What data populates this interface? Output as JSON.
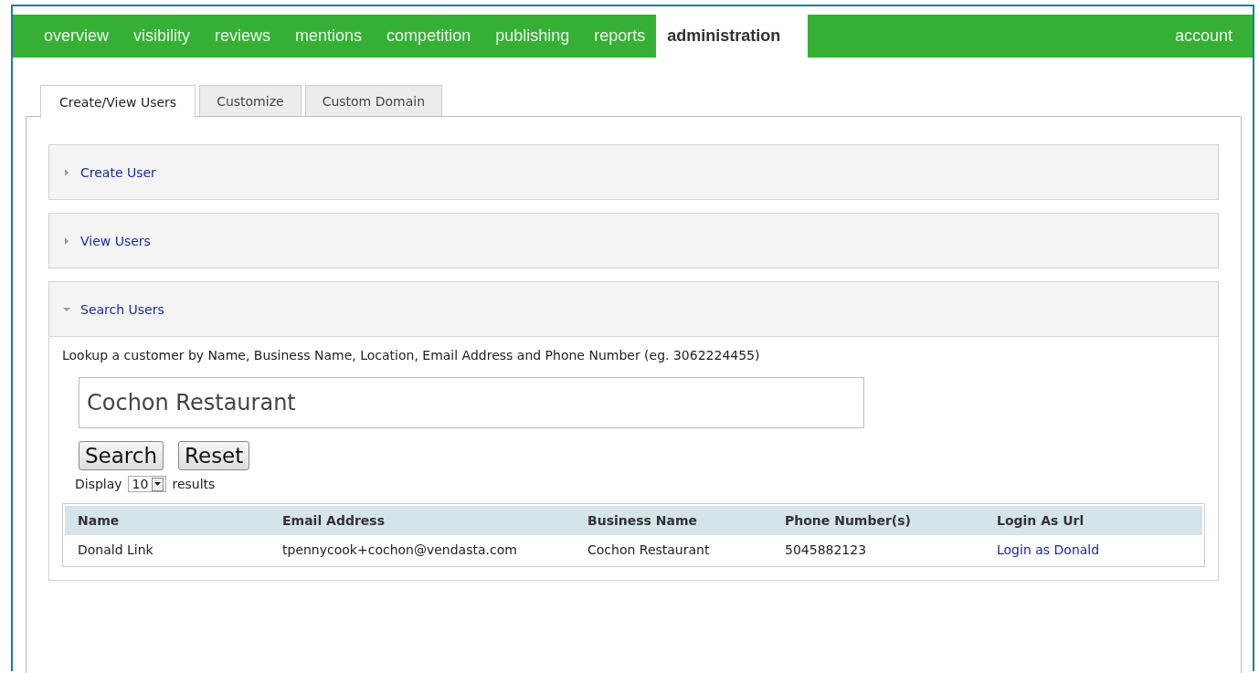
{
  "nav": {
    "items": [
      {
        "label": "overview",
        "selected": false
      },
      {
        "label": "visibility",
        "selected": false
      },
      {
        "label": "reviews",
        "selected": false
      },
      {
        "label": "mentions",
        "selected": false
      },
      {
        "label": "competition",
        "selected": false
      },
      {
        "label": "publishing",
        "selected": false
      },
      {
        "label": "reports",
        "selected": false
      },
      {
        "label": "administration",
        "selected": true
      }
    ],
    "account": "account"
  },
  "tabs": [
    {
      "label": "Create/View Users",
      "selected": true
    },
    {
      "label": "Customize",
      "selected": false
    },
    {
      "label": "Custom Domain",
      "selected": false
    }
  ],
  "sections": [
    {
      "title": "Create User",
      "expanded": false
    },
    {
      "title": "View Users",
      "expanded": false
    },
    {
      "title": "Search Users",
      "expanded": true
    }
  ],
  "search": {
    "hint": "Lookup a customer by Name, Business Name, Location, Email Address and Phone Number (eg. 3062224455)",
    "value": "Cochon Restaurant",
    "buttons": [
      "Search",
      "Reset"
    ],
    "display_label": "Display",
    "page_size": "10",
    "results_label": "results"
  },
  "table": {
    "columns": [
      "Name",
      "Email Address",
      "Business Name",
      "Phone Number(s)",
      "Login As Url"
    ],
    "rows": [
      {
        "name": "Donald Link",
        "email": "tpennycook+cochon@vendasta.com",
        "business": "Cochon Restaurant",
        "phone": "5045882123",
        "login": "Login as Donald"
      }
    ]
  }
}
